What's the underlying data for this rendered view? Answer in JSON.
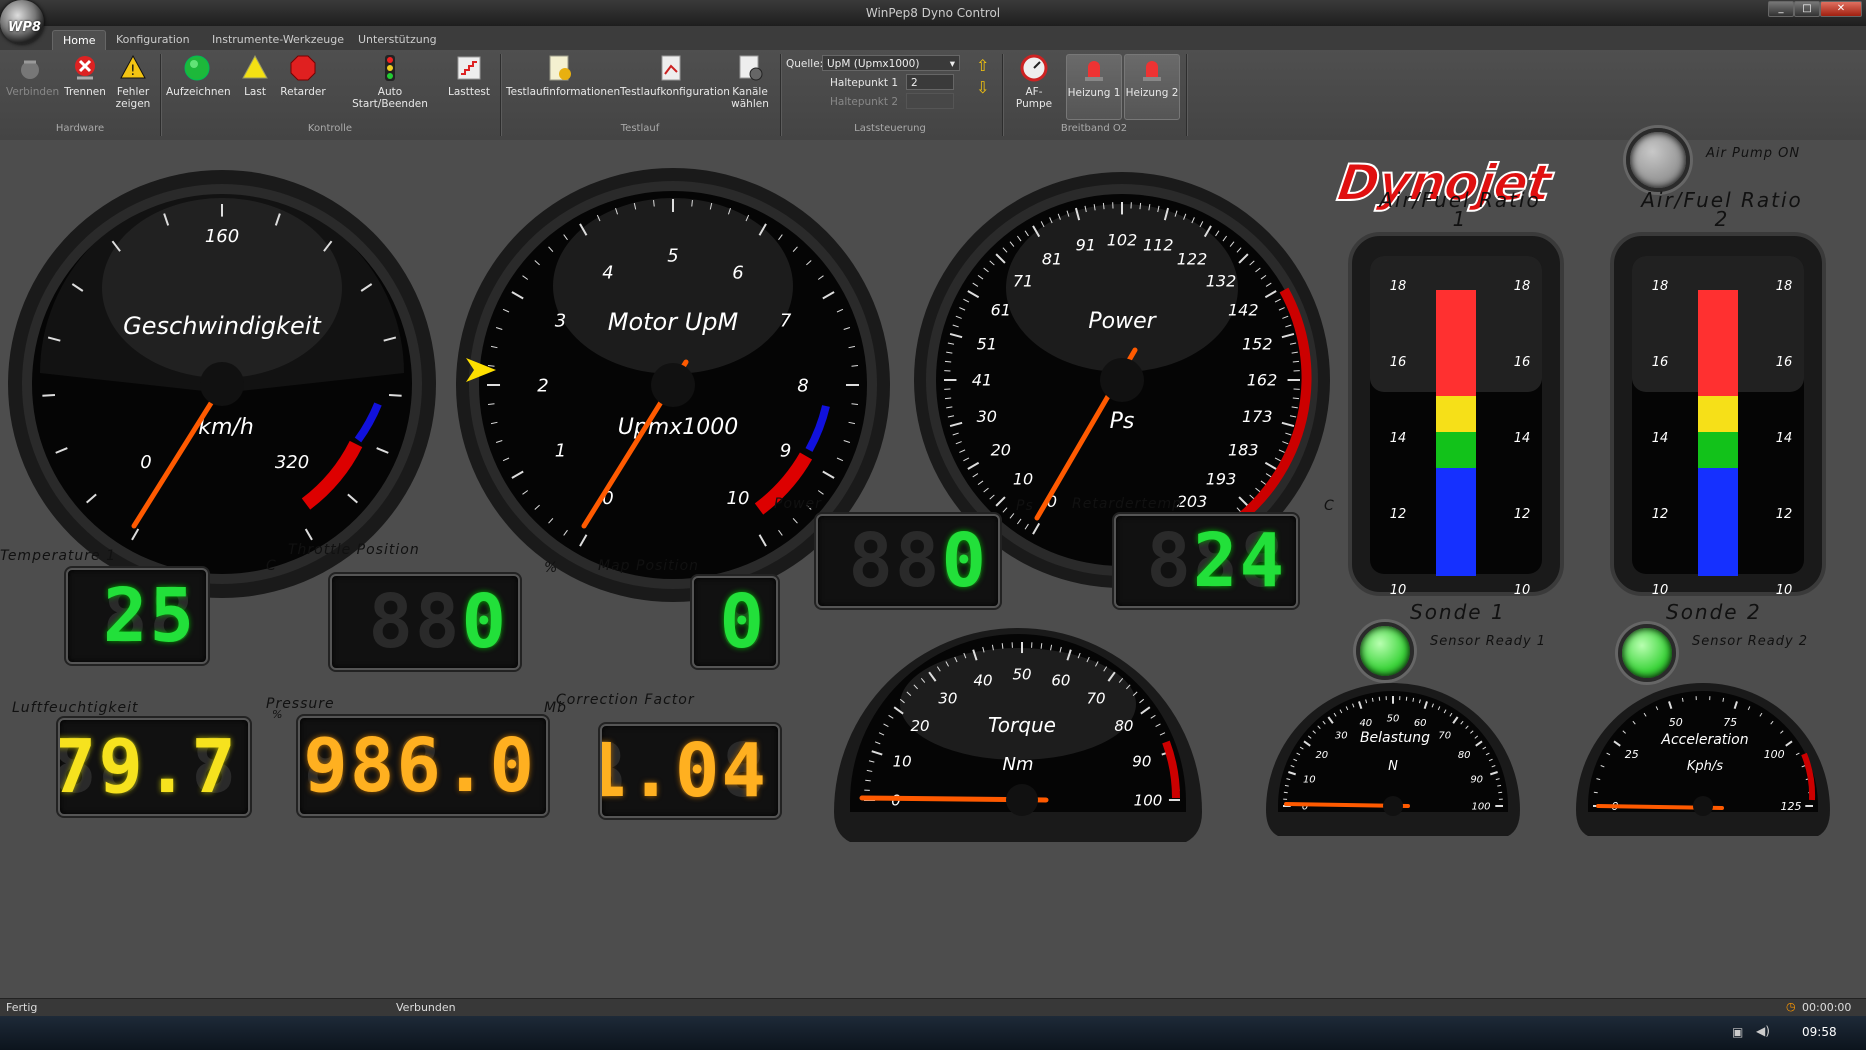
{
  "window": {
    "title": "WinPep8 Dyno Control",
    "logo": "WP8"
  },
  "tabs": [
    "Home",
    "Konfiguration",
    "Instrumente-Werkzeuge",
    "Unterstützung"
  ],
  "ribbon": {
    "hardware": {
      "group": "Hardware",
      "connect": "Verbinden",
      "disconnect": "Trennen",
      "errors": "Fehler zeigen"
    },
    "control": {
      "group": "Kontrolle",
      "record": "Aufzeichnen",
      "load": "Last",
      "retarder": "Retarder",
      "auto": "Auto Start/Beenden",
      "loadtest": "Lasttest"
    },
    "run": {
      "group": "Testlauf",
      "info": "Testlaufinformationen",
      "config": "Testlaufkonfiguration",
      "channels": "Kanäle wählen"
    },
    "load_control": {
      "group": "Laststeuerung",
      "source_label": "Quelle:",
      "source_value": "UpM (Upmx1000)",
      "hold1_label": "Haltepunkt 1",
      "hold1_value": "2",
      "hold2_label": "Haltepunkt 2",
      "hold2_value": ""
    },
    "o2": {
      "group": "Breitband O2",
      "pump": "AF-Pumpe",
      "heat1": "Heizung 1",
      "heat2": "Heizung 2"
    }
  },
  "gauges": {
    "speed": {
      "title": "Geschwindigkeit",
      "unit": "km/h",
      "ticks": [
        "0",
        "160",
        "320"
      ],
      "value": 0
    },
    "rpm": {
      "title": "Motor UpM",
      "unit": "Upmx1000",
      "ticks": [
        "0",
        "1",
        "2",
        "3",
        "4",
        "5",
        "6",
        "7",
        "8",
        "9",
        "10"
      ],
      "value": 0
    },
    "power": {
      "title": "Power",
      "unit": "Ps",
      "ticks": [
        "0",
        "10",
        "20",
        "30",
        "41",
        "51",
        "61",
        "71",
        "81",
        "91",
        "102",
        "112",
        "122",
        "132",
        "142",
        "152",
        "162",
        "173",
        "183",
        "193",
        "203"
      ],
      "value": 0
    },
    "torque": {
      "title": "Torque",
      "unit": "Nm",
      "ticks": [
        "0",
        "10",
        "20",
        "30",
        "40",
        "50",
        "60",
        "70",
        "80",
        "90",
        "100"
      ],
      "value": 0
    },
    "load": {
      "title": "Belastung",
      "unit": "N",
      "ticks": [
        "0",
        "10",
        "20",
        "30",
        "40",
        "50",
        "60",
        "70",
        "80",
        "90",
        "100"
      ],
      "value": 0
    },
    "accel": {
      "title": "Acceleration",
      "unit": "Kph/s",
      "ticks": [
        "0",
        "25",
        "50",
        "75",
        "100",
        "125"
      ],
      "value": 0
    }
  },
  "afr": [
    {
      "title": "Air/Fuel Ratio",
      "index": "1",
      "ticks": [
        "18",
        "16",
        "14",
        "12",
        "10"
      ],
      "sonde": "Sonde 1",
      "ready": "Sensor Ready 1"
    },
    {
      "title": "Air/Fuel Ratio",
      "index": "2",
      "ticks": [
        "18",
        "16",
        "14",
        "12",
        "10"
      ],
      "sonde": "Sonde 2",
      "ready": "Sensor Ready 2"
    }
  ],
  "brand": "Dynojet",
  "air_pump": "Air Pump ON",
  "digitals": {
    "temperature": {
      "label": "Temperature 1",
      "unit": "C",
      "value": "25",
      "ghost": "88"
    },
    "throttle": {
      "label": "Throttle Position",
      "unit": "%",
      "value": "0",
      "ghost": "888"
    },
    "map": {
      "label": "Map Position",
      "value": "0",
      "ghost": "8"
    },
    "power": {
      "label": "Power",
      "unit": "Ps",
      "value": "0",
      "ghost": "888"
    },
    "retarder": {
      "label": "Retardertemp",
      "unit": "C",
      "value": "24",
      "ghost": "888"
    },
    "humidity": {
      "label": "Luftfeuchtigkeit",
      "unit": "%",
      "value": "79.7",
      "ghost": "88.8"
    },
    "pressure": {
      "label": "Pressure",
      "unit": "Mb",
      "value": "986.0",
      "ghost": "888.8"
    },
    "correction": {
      "label": "Correction Factor",
      "value": "1.04",
      "ghost": "8.88"
    }
  },
  "status": {
    "left": "Fertig",
    "mid": "Verbunden",
    "timer": "00:00:00"
  },
  "taskbar": {
    "clock": "09:58"
  }
}
